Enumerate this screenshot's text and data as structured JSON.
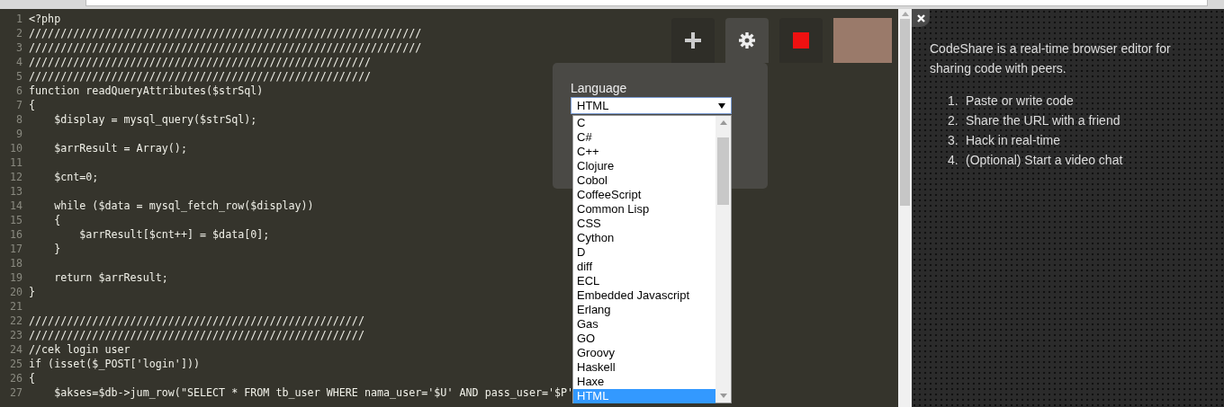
{
  "editor": {
    "lines": [
      {
        "number": "1",
        "text": "<?php"
      },
      {
        "number": "2",
        "text": "//////////////////////////////////////////////////////////////"
      },
      {
        "number": "3",
        "text": "//////////////////////////////////////////////////////////////"
      },
      {
        "number": "4",
        "text": "//////////////////////////////////////////////////////"
      },
      {
        "number": "5",
        "text": "//////////////////////////////////////////////////////"
      },
      {
        "number": "6",
        "text": "function readQueryAttributes($strSql)"
      },
      {
        "number": "7",
        "text": "{"
      },
      {
        "number": "8",
        "text": "    $display = mysql_query($strSql);"
      },
      {
        "number": "9"
      },
      {
        "number": "10",
        "text": "    $arrResult = Array();"
      },
      {
        "number": "11"
      },
      {
        "number": "12",
        "text": "    $cnt=0;"
      },
      {
        "number": "13"
      },
      {
        "number": "14",
        "text": "    while ($data = mysql_fetch_row($display))"
      },
      {
        "number": "15",
        "text": "    {"
      },
      {
        "number": "16",
        "text": "        $arrResult[$cnt++] = $data[0];"
      },
      {
        "number": "17",
        "text": "    }"
      },
      {
        "number": "18"
      },
      {
        "number": "19",
        "text": "    return $arrResult;"
      },
      {
        "number": "20",
        "text": "}"
      },
      {
        "number": "21"
      },
      {
        "number": "22",
        "text": "/////////////////////////////////////////////////////"
      },
      {
        "number": "23",
        "text": "/////////////////////////////////////////////////////"
      },
      {
        "number": "24",
        "text": "//cek login user"
      },
      {
        "number": "25",
        "text": "if (isset($_POST['login']))"
      },
      {
        "number": "26",
        "text": "{"
      },
      {
        "number": "27",
        "text": "    $akses=$db->jum_row(\"SELECT * FROM tb_user WHERE nama_user='$U' AND pass_user='$P'"
      }
    ]
  },
  "toolbar": [
    {
      "kind": "add",
      "selected": false
    },
    {
      "kind": "settings",
      "selected": true
    },
    {
      "kind": "stop",
      "selected": false
    },
    {
      "kind": "video"
    }
  ],
  "settings": {
    "label": "Language",
    "value": "HTML",
    "options": [
      {
        "label": "C",
        "selected": false
      },
      {
        "label": "C#",
        "selected": false
      },
      {
        "label": "C++",
        "selected": false
      },
      {
        "label": "Clojure",
        "selected": false
      },
      {
        "label": "Cobol",
        "selected": false
      },
      {
        "label": "CoffeeScript",
        "selected": false
      },
      {
        "label": "Common Lisp",
        "selected": false
      },
      {
        "label": "CSS",
        "selected": false
      },
      {
        "label": "Cython",
        "selected": false
      },
      {
        "label": "D",
        "selected": false
      },
      {
        "label": "diff",
        "selected": false
      },
      {
        "label": "ECL",
        "selected": false
      },
      {
        "label": "Embedded Javascript",
        "selected": false
      },
      {
        "label": "Erlang",
        "selected": false
      },
      {
        "label": "Gas",
        "selected": false
      },
      {
        "label": "GO",
        "selected": false
      },
      {
        "label": "Groovy",
        "selected": false
      },
      {
        "label": "Haskell",
        "selected": false
      },
      {
        "label": "Haxe",
        "selected": false
      },
      {
        "label": "HTML",
        "selected": true
      }
    ]
  },
  "sidebar": {
    "intro": "CodeShare is a real-time browser editor for sharing code with peers.",
    "steps": [
      {
        "number": "1.",
        "text": "Paste or write code"
      },
      {
        "number": "2.",
        "text": "Share the URL with a friend"
      },
      {
        "number": "3.",
        "text": "Hack in real-time"
      },
      {
        "number": "4.",
        "text": "(Optional) Start a video chat"
      }
    ]
  }
}
